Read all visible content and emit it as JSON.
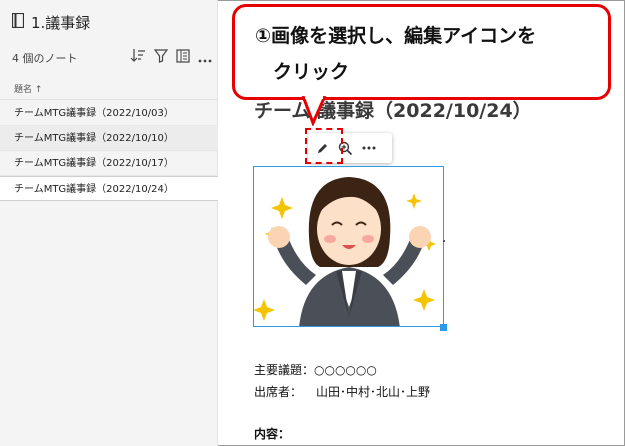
{
  "sidebar": {
    "notebook_title": "1.議事録",
    "note_count": "4 個のノート",
    "column_header": "題名 ↑",
    "notes": [
      {
        "title": "チームMTG議事録（2022/10/03）"
      },
      {
        "title": "チームMTG議事録（2022/10/10）"
      },
      {
        "title": "チームMTG議事録（2022/10/17）"
      },
      {
        "title": "チームMTG議事録（2022/10/24）"
      }
    ],
    "selected_index": 3
  },
  "page": {
    "title": "チーム     議事録（2022/10/24）",
    "fields": {
      "agenda_label": "主要議題：",
      "agenda_value": "○○○○○○",
      "attendees_label": "出席者：",
      "attendees_value": "山田･中村･北山･上野",
      "content_label": "内容："
    }
  },
  "image_toolbar": {
    "icons": [
      "pencil-edit-icon",
      "zoom-in-icon",
      "more-options-icon"
    ]
  },
  "callout": {
    "line1": "①画像を選択し、編集アイコンを",
    "line2": "クリック"
  },
  "colors": {
    "callout_border": "#e60000",
    "selection_blue": "#2b9be8",
    "dashed_highlight": "#e00000"
  }
}
